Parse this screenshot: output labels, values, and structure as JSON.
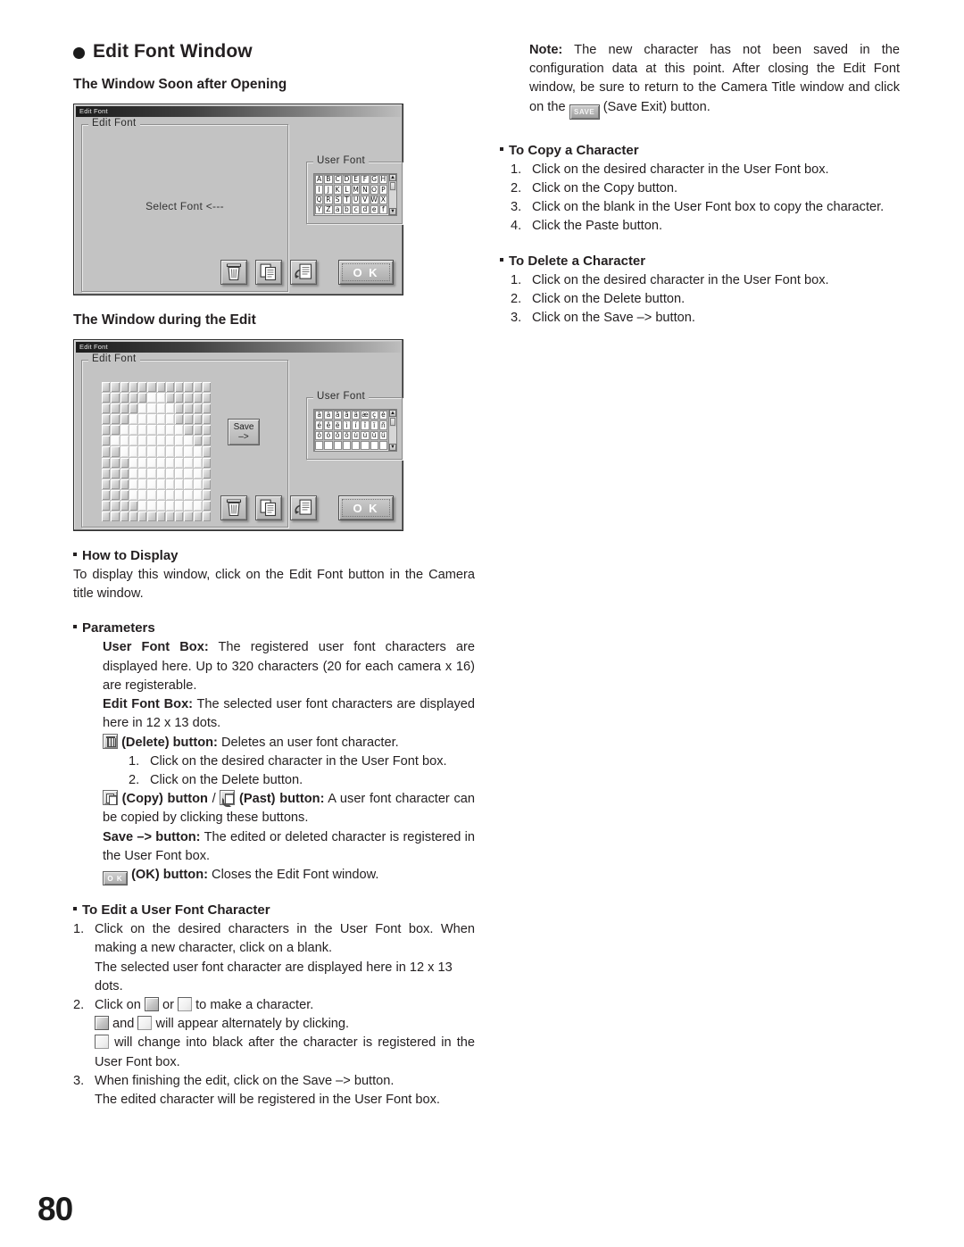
{
  "page": {
    "number": "80"
  },
  "left": {
    "title": "Edit Font Window",
    "sub1": "The Window Soon after Opening",
    "sub2": "The Window during the Edit",
    "how_to_display": {
      "heading": "How to Display",
      "body": "To display this window, click on the Edit Font button in the Camera title window."
    },
    "parameters": {
      "heading": "Parameters",
      "user_font_box_label": "User Font Box:",
      "user_font_box_text": " The registered user font characters are displayed here. Up to 320 characters (20 for each camera x 16) are registerable.",
      "edit_font_box_label": "Edit Font Box:",
      "edit_font_box_text": " The selected user font characters are displayed here in 12 x 13 dots.",
      "delete_label": "(Delete) button:",
      "delete_text": " Deletes an user font character.",
      "delete_steps": [
        "Click on the desired character in the User Font box.",
        "Click on the Delete button."
      ],
      "copy_label": "(Copy) button",
      "copy_separator": "/",
      "paste_label": "(Past) button:",
      "copy_paste_text": " A user font character can be copied by clicking these buttons.",
      "save_label": "Save –> button:",
      "save_text": " The edited or deleted character is registered in the User Font box.",
      "ok_label": "(OK) button:",
      "ok_text": " Closes the Edit Font window."
    },
    "edit_char": {
      "heading": "To Edit a User Font Character",
      "step1_a": "Click on the desired characters in the User Font box. When making a new character, click on a blank.",
      "step1_b": "The selected user font character are displayed here in 12 x 13 dots.",
      "step2_a": "Click on ",
      "step2_b": " or ",
      "step2_c": " to make a character.",
      "step2_d_a": " and ",
      "step2_d_b": " will appear alternately by clicking.",
      "step2_e": " will change into black after the character is registered in the User Font box.",
      "step3_a": "When finishing the edit, click on the Save –> button.",
      "step3_b": "The edited character will be registered in the User Font box."
    }
  },
  "right": {
    "note": {
      "label": "Note:",
      "text_before": " The new character has not been saved in the configuration data at this point. After closing the Edit Font window, be sure to return to the Camera Title window and click on the ",
      "button_label": "SAVE",
      "text_after": " (Save Exit) button."
    },
    "copy_char": {
      "heading": "To Copy a Character",
      "steps": [
        "Click on the desired character in the User Font box.",
        "Click on the Copy button.",
        "Click on the blank in the User Font box to copy the character.",
        "Click the Paste button."
      ]
    },
    "delete_char": {
      "heading": "To Delete a Character",
      "steps": [
        "Click on the desired character in the User Font box.",
        "Click on the Delete button.",
        "Click on the Save –> button."
      ]
    }
  },
  "dialog1": {
    "titlebar": "Edit Font",
    "group_edit_legend": "Edit Font",
    "group_user_legend": "User Font",
    "select_font_label": "Select Font <---",
    "user_font_chars": [
      "A",
      "B",
      "C",
      "D",
      "E",
      "F",
      "G",
      "H",
      "I",
      "J",
      "K",
      "L",
      "M",
      "N",
      "O",
      "P",
      "Q",
      "R",
      "S",
      "T",
      "U",
      "V",
      "W",
      "X",
      "Y",
      "Z",
      "a",
      "b",
      "c",
      "d",
      "e",
      "f"
    ],
    "ok_label": "O K",
    "scroll_up": "▲",
    "scroll_down": "▼"
  },
  "dialog2": {
    "titlebar": "Edit Font",
    "group_edit_legend": "Edit Font",
    "group_user_legend": "User Font",
    "save_label_line1": "Save",
    "save_label_line2": "–>",
    "user_font_chars": [
      "à",
      "á",
      "â",
      "ã",
      "ä",
      "æ",
      "ç",
      "è",
      "é",
      "ê",
      "ë",
      "ì",
      "í",
      "î",
      "ï",
      "ñ",
      "ò",
      "ó",
      "ô",
      "õ",
      "ù",
      "ú",
      "û",
      "ü",
      "",
      "",
      "",
      "",
      "",
      "",
      "",
      ""
    ],
    "ok_label": "O K",
    "scroll_up": "▲",
    "scroll_down": "▼",
    "dot_matrix": [
      [
        0,
        0,
        0,
        0,
        0,
        0,
        0,
        0,
        0,
        0,
        0,
        0
      ],
      [
        0,
        0,
        0,
        0,
        0,
        1,
        1,
        0,
        0,
        0,
        0,
        0
      ],
      [
        0,
        0,
        0,
        0,
        1,
        1,
        1,
        1,
        0,
        0,
        0,
        0
      ],
      [
        0,
        0,
        0,
        1,
        1,
        1,
        1,
        1,
        0,
        0,
        0,
        0
      ],
      [
        0,
        0,
        1,
        1,
        1,
        1,
        1,
        1,
        1,
        0,
        0,
        0
      ],
      [
        0,
        1,
        1,
        1,
        1,
        1,
        1,
        1,
        1,
        1,
        0,
        0
      ],
      [
        0,
        0,
        1,
        1,
        1,
        1,
        1,
        1,
        1,
        1,
        1,
        0
      ],
      [
        0,
        0,
        0,
        1,
        1,
        1,
        1,
        1,
        1,
        1,
        1,
        0
      ],
      [
        0,
        0,
        0,
        1,
        1,
        1,
        1,
        1,
        1,
        1,
        1,
        0
      ],
      [
        0,
        0,
        0,
        1,
        1,
        1,
        1,
        1,
        1,
        1,
        1,
        0
      ],
      [
        0,
        0,
        0,
        1,
        1,
        1,
        1,
        1,
        1,
        1,
        1,
        0
      ],
      [
        0,
        0,
        0,
        0,
        1,
        1,
        1,
        1,
        1,
        1,
        1,
        0
      ],
      [
        0,
        0,
        0,
        0,
        0,
        0,
        0,
        0,
        0,
        0,
        0,
        0
      ]
    ]
  },
  "icons": {
    "trash": "trash-icon",
    "copy": "copy-icon",
    "paste": "paste-icon"
  }
}
